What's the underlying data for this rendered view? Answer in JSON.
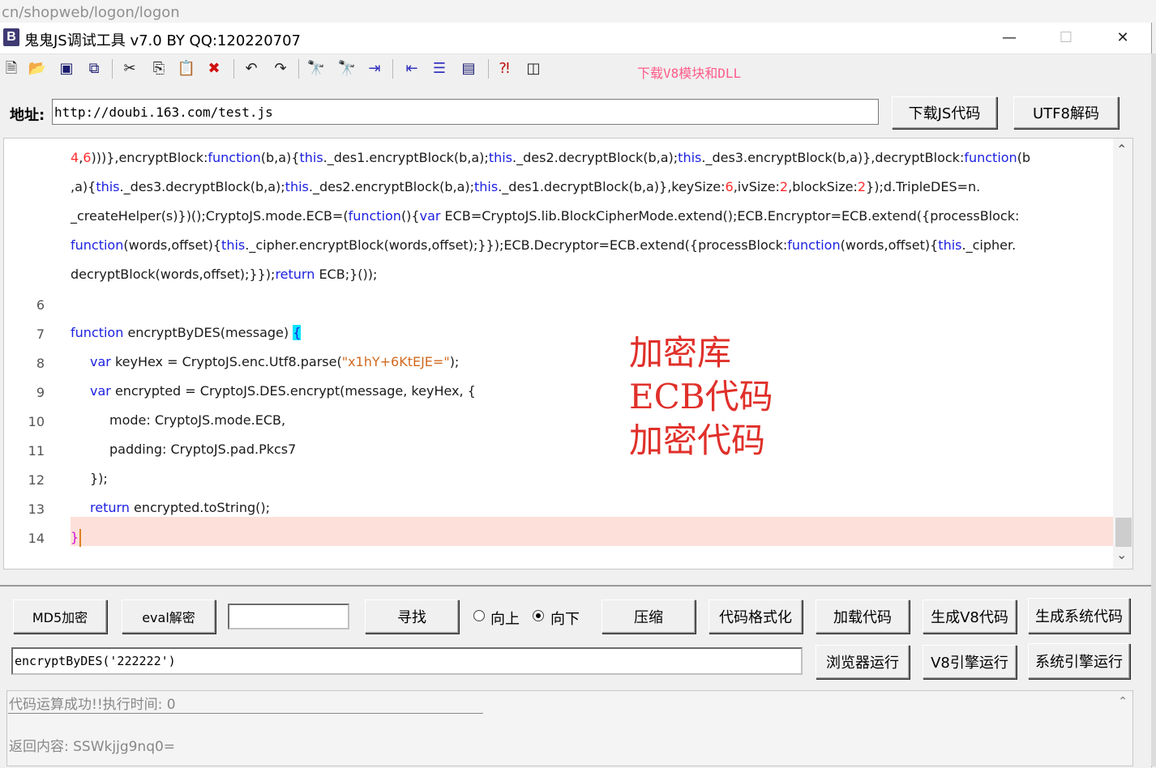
{
  "browser": {
    "url_fragment": "cn/shopweb/logon/logon"
  },
  "window": {
    "title": "鬼鬼JS调试工具 v7.0 BY QQ:120220707",
    "app_icon_letter": "B",
    "controls": {
      "minimize": "—",
      "maximize": "☐",
      "close": "✕"
    }
  },
  "toolbar": {
    "icons": [
      "new-file-icon",
      "open-folder-icon",
      "save-icon",
      "save-all-icon",
      "cut-icon",
      "copy-icon",
      "paste-icon",
      "delete-icon",
      "undo-icon",
      "redo-icon",
      "find-icon",
      "find-next-icon",
      "indent-icon",
      "outdent-icon",
      "numbered-list-icon",
      "window-icon",
      "help-cursor-icon",
      "column-icon"
    ],
    "download_link": "下载V8模块和DLL"
  },
  "address": {
    "label": "地址:",
    "value": "http://doubi.163.com/test.js",
    "download_button": "下载JS代码",
    "utf8_button": "UTF8解码"
  },
  "editor": {
    "lines": [
      {
        "num": "",
        "text": "4,6)))},encryptBlock:function(b,a){this._des1.encryptBlock(b,a);this._des2.decryptBlock(b,a);this._des3.encryptBlock(b,a)},decryptBlock:function(b"
      },
      {
        "num": "",
        "text": ",a){this._des3.decryptBlock(b,a);this._des2.encryptBlock(b,a);this._des1.decryptBlock(b,a)},keySize:6,ivSize:2,blockSize:2});d.TripleDES=n."
      },
      {
        "num": "",
        "text": "_createHelper(s)})();CryptoJS.mode.ECB=(function(){var ECB=CryptoJS.lib.BlockCipherMode.extend();ECB.Encryptor=ECB.extend({processBlock:"
      },
      {
        "num": "",
        "text": "function(words,offset){this._cipher.encryptBlock(words,offset);}});ECB.Decryptor=ECB.extend({processBlock:function(words,offset){this._cipher."
      },
      {
        "num": "",
        "text": "decryptBlock(words,offset);}});return ECB;}());"
      },
      {
        "num": "6",
        "text": ""
      },
      {
        "num": "7",
        "text": "function encryptByDES(message) {"
      },
      {
        "num": "8",
        "text": "var keyHex = CryptoJS.enc.Utf8.parse(\"x1hY+6KtEJE=\");"
      },
      {
        "num": "9",
        "text": "var encrypted = CryptoJS.DES.encrypt(message, keyHex, {"
      },
      {
        "num": "10",
        "text": "mode: CryptoJS.mode.ECB,"
      },
      {
        "num": "11",
        "text": "padding: CryptoJS.pad.Pkcs7"
      },
      {
        "num": "12",
        "text": "});"
      },
      {
        "num": "13",
        "text": "return encrypted.toString();"
      },
      {
        "num": "14",
        "text": "}"
      }
    ],
    "scroll_up": "⌃",
    "scroll_down": "⌄"
  },
  "overlay_annotation": [
    "加密库",
    "ECB代码",
    "加密代码"
  ],
  "controls": {
    "md5_button": "MD5加密",
    "eval_button": "eval解密",
    "search_value": "",
    "find_button": "寻找",
    "radio_up": "向上",
    "radio_down": "向下",
    "compress_button": "压缩",
    "format_button": "代码格式化",
    "load_button": "加载代码",
    "gen_v8_button": "生成V8代码",
    "gen_sys_button": "生成系统代码",
    "command_value": "encryptByDES('222222')",
    "browser_run_button": "浏览器运行",
    "v8_run_button": "V8引擎运行",
    "sys_run_button": "系统引擎运行"
  },
  "output": {
    "status": "代码运算成功!!执行时间: 0",
    "result": "返回内容: SSWkjjg9nq0="
  },
  "colors": {
    "keyword": "#1d22e0",
    "number": "#ff2d2d",
    "string": "#d2691e",
    "annotation": "#e0302a",
    "link": "#ff5b8a",
    "highlight": "#fde0da"
  }
}
